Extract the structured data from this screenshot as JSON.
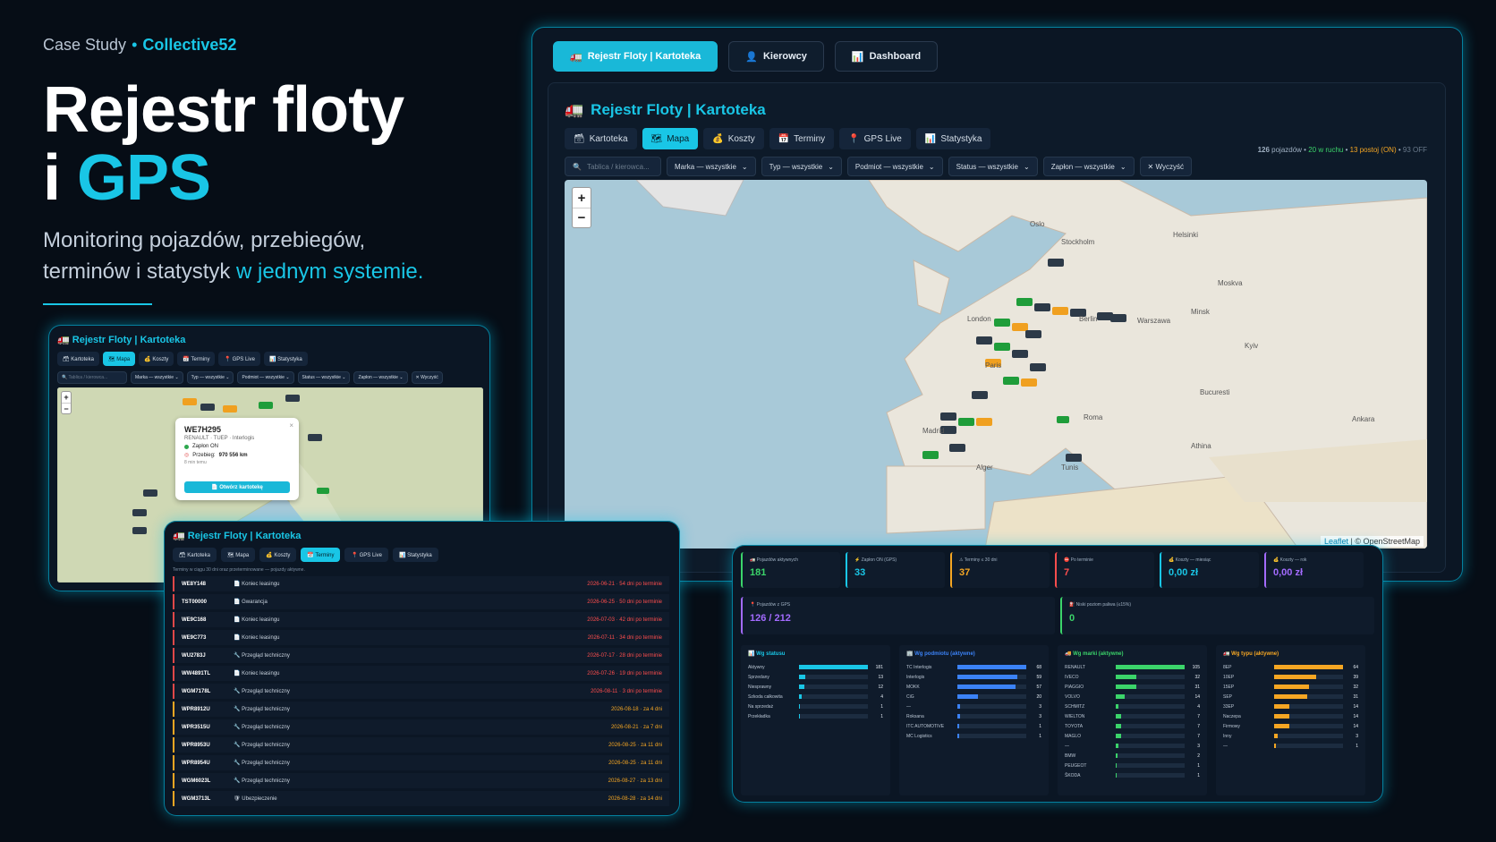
{
  "hero": {
    "kicker": "Case Study",
    "bullet": "•",
    "brand": "Collective52",
    "title_line1": "Rejestr floty",
    "title_line2_prefix": "i ",
    "title_line2_accent": "GPS",
    "subtitle_line1": "Monitoring pojazdów, przebiegów,",
    "subtitle_line2_prefix": "terminów i statystyk ",
    "subtitle_line2_accent": "w jednym systemie."
  },
  "main": {
    "top_tabs": [
      {
        "label": "Rejestr Floty | Kartoteka",
        "icon": "🚛"
      },
      {
        "label": "Kierowcy",
        "icon": "👤"
      },
      {
        "label": "Dashboard",
        "icon": "📊"
      }
    ],
    "title": "Rejestr Floty | Kartoteka",
    "title_icon": "🚛",
    "tabs": [
      {
        "label": "Kartoteka",
        "icon": "🗃"
      },
      {
        "label": "Mapa",
        "icon": "🗺"
      },
      {
        "label": "Koszty",
        "icon": "💰"
      },
      {
        "label": "Terminy",
        "icon": "📅"
      },
      {
        "label": "GPS Live",
        "icon": "📍"
      },
      {
        "label": "Statystyka",
        "icon": "📊"
      }
    ],
    "stats": {
      "count": "126",
      "count_label": " pojazdów •",
      "moving": " 20 w ruchu",
      "sep": " •",
      "idle": " 13 postoj (ON)",
      "sep2": " •",
      "off": " 93 OFF"
    },
    "search_placeholder": "Tablica / kierowca...",
    "search_icon": "🔍",
    "filters": [
      "Marka — wszystkie",
      "Typ — wszystkie",
      "Podmiot — wszystkie",
      "Status — wszystkie",
      "Zapłon — wszystkie"
    ],
    "clear_label": "✕ Wyczyść",
    "zoom_in": "+",
    "zoom_out": "−",
    "attribution_leaflet": "Leaflet",
    "attribution_sep": " | © OpenStreetMap",
    "cities": [
      "Oslo",
      "Stockholm",
      "Moskva",
      "London",
      "Roma",
      "Madrid",
      "Alger",
      "Tunis",
      "Helsinki",
      "Kyiv",
      "Ankara",
      "Minsk",
      "Warszawa",
      "Berlin",
      "Paris",
      "Bucuresti",
      "Athina"
    ]
  },
  "small_map": {
    "title": "🚛 Rejestr Floty | Kartoteka",
    "tabs": [
      "🗃 Kartoteka",
      "🗺 Mapa",
      "💰 Koszty",
      "📅 Terminy",
      "📍 GPS Live",
      "📊 Statystyka"
    ],
    "search_placeholder": "🔍 Tablica / kierowca...",
    "filters": [
      "Marka — wszystkie ⌄",
      "Typ — wszystkie ⌄",
      "Podmiot — wszystkie ⌄",
      "Status — wszystkie ⌄",
      "Zapłon — wszystkie ⌄",
      "✕ Wyczyść"
    ],
    "zoom_in": "+",
    "zoom_out": "−",
    "popup": {
      "plate": "WE7H295",
      "model": "RENAULT · TUEP · Interlogis",
      "ignition": "Zapłon ON",
      "mileage_label": "Przebieg: ",
      "mileage_value": "970 556 km",
      "time": "8 min temu",
      "button": "📄 Otwórz kartotekę",
      "close": "×"
    }
  },
  "terms": {
    "title": "🚛 Rejestr Floty | Kartoteka",
    "tabs": [
      "🗃 Kartoteka",
      "🗺 Mapa",
      "💰 Koszty",
      "📅 Terminy",
      "📍 GPS Live",
      "📊 Statystyka"
    ],
    "note": "Terminy w ciągu 30 dni oraz przeterminowane — pojazdy aktywne.",
    "rows": [
      {
        "plate": "WE8Y148",
        "name": "📄 Koniec leasingu",
        "date": "2026-06-21 · 54 dni po terminie",
        "kind": "red"
      },
      {
        "plate": "TST00000",
        "name": "📄 Gwarancja",
        "date": "2026-06-25 · 50 dni po terminie",
        "kind": "red"
      },
      {
        "plate": "WE9C168",
        "name": "📄 Koniec leasingu",
        "date": "2026-07-03 · 42 dni po terminie",
        "kind": "red"
      },
      {
        "plate": "WE9C773",
        "name": "📄 Koniec leasingu",
        "date": "2026-07-11 · 34 dni po terminie",
        "kind": "red"
      },
      {
        "plate": "WU2783J",
        "name": "🔧 Przegląd techniczny",
        "date": "2026-07-17 · 28 dni po terminie",
        "kind": "red"
      },
      {
        "plate": "WW4891TL",
        "name": "📄 Koniec leasingu",
        "date": "2026-07-26 · 19 dni po terminie",
        "kind": "red"
      },
      {
        "plate": "WGM7178L",
        "name": "🔧 Przegląd techniczny",
        "date": "2026-08-11 · 3 dni po terminie",
        "kind": "red"
      },
      {
        "plate": "WPR8912U",
        "name": "🔧 Przegląd techniczny",
        "date": "2026-08-18 · za 4 dni",
        "kind": "orange"
      },
      {
        "plate": "WPR3515U",
        "name": "🔧 Przegląd techniczny",
        "date": "2026-08-21 · za 7 dni",
        "kind": "orange"
      },
      {
        "plate": "WPR8953U",
        "name": "🔧 Przegląd techniczny",
        "date": "2026-08-25 · za 11 dni",
        "kind": "orange"
      },
      {
        "plate": "WPR8954U",
        "name": "🔧 Przegląd techniczny",
        "date": "2026-08-25 · za 11 dni",
        "kind": "orange"
      },
      {
        "plate": "WGM6023L",
        "name": "🔧 Przegląd techniczny",
        "date": "2026-08-27 · za 13 dni",
        "kind": "orange"
      },
      {
        "plate": "WGM3713L",
        "name": "🛡 Ubezpieczenie",
        "date": "2026-08-28 · za 14 dni",
        "kind": "orange"
      }
    ]
  },
  "statistics": {
    "kpis": [
      {
        "label": "🚛 Pojazdów aktywnych",
        "value": "181",
        "color": "#3bd46a"
      },
      {
        "label": "⚡ Zapłon ON (GPS)",
        "value": "33",
        "color": "#19c6e6"
      },
      {
        "label": "⚠ Terminy ≤ 30 dni",
        "value": "37",
        "color": "#f5a623"
      },
      {
        "label": "⛔ Po terminie",
        "value": "7",
        "color": "#ff4d4d"
      },
      {
        "label": "💰 Koszty — miesiąc",
        "value": "0,00 zł",
        "color": "#19c6e6"
      },
      {
        "label": "💰 Koszty — rok",
        "value": "0,00 zł",
        "color": "#a36bff"
      }
    ],
    "kpis2": [
      {
        "label": "📍 Pojazdów z GPS",
        "value": "126 / 212",
        "color": "#a36bff"
      },
      {
        "label": "⛽ Niski poziom paliwa (≤15%)",
        "value": "0",
        "color": "#3bd46a"
      }
    ],
    "panels": [
      {
        "title": "📊 Wg statusu",
        "color": "#19c6e6",
        "rows": [
          {
            "label": "Aktywny",
            "value": 181,
            "frac": 1.0
          },
          {
            "label": "Sprzedany",
            "value": 13,
            "frac": 0.09
          },
          {
            "label": "Niesprawny",
            "value": 12,
            "frac": 0.08
          },
          {
            "label": "Szkoda całkowita",
            "value": 4,
            "frac": 0.03
          },
          {
            "label": "Na sprzedaż",
            "value": 1,
            "frac": 0.01
          },
          {
            "label": "Przekładka",
            "value": 1,
            "frac": 0.01
          }
        ]
      },
      {
        "title": "🏢 Wg podmiotu (aktywne)",
        "color": "#3b82f6",
        "rows": [
          {
            "label": "TC Interlogis",
            "value": 68,
            "frac": 1.0
          },
          {
            "label": "Interlogis",
            "value": 59,
            "frac": 0.87
          },
          {
            "label": "MOKK",
            "value": 57,
            "frac": 0.84
          },
          {
            "label": "CiG",
            "value": 20,
            "frac": 0.3
          },
          {
            "label": "—",
            "value": 3,
            "frac": 0.04
          },
          {
            "label": "Roksana",
            "value": 3,
            "frac": 0.04
          },
          {
            "label": "ITC AUTOMOTIVE",
            "value": 1,
            "frac": 0.02
          },
          {
            "label": "MC Logistics",
            "value": 1,
            "frac": 0.02
          }
        ]
      },
      {
        "title": "🚚 Wg marki (aktywne)",
        "color": "#3bd46a",
        "rows": [
          {
            "label": "RENAULT",
            "value": 105,
            "frac": 1.0
          },
          {
            "label": "IVECO",
            "value": 32,
            "frac": 0.3
          },
          {
            "label": "PIAGGIO",
            "value": 31,
            "frac": 0.3
          },
          {
            "label": "VOLVO",
            "value": 14,
            "frac": 0.13
          },
          {
            "label": "SCHMITZ",
            "value": 4,
            "frac": 0.04
          },
          {
            "label": "WIELTON",
            "value": 7,
            "frac": 0.07
          },
          {
            "label": "TOYOTA",
            "value": 7,
            "frac": 0.07
          },
          {
            "label": "MAGLO",
            "value": 7,
            "frac": 0.07
          },
          {
            "label": "—",
            "value": 3,
            "frac": 0.03
          },
          {
            "label": "BMW",
            "value": 2,
            "frac": 0.02
          },
          {
            "label": "PEUGEOT",
            "value": 1,
            "frac": 0.01
          },
          {
            "label": "ŠKODA",
            "value": 1,
            "frac": 0.01
          }
        ]
      },
      {
        "title": "🚛 Wg typu (aktywne)",
        "color": "#f5a623",
        "rows": [
          {
            "label": "8EP",
            "value": 64,
            "frac": 1.0
          },
          {
            "label": "10EP",
            "value": 39,
            "frac": 0.61
          },
          {
            "label": "15EP",
            "value": 32,
            "frac": 0.5
          },
          {
            "label": "SEP",
            "value": 31,
            "frac": 0.48
          },
          {
            "label": "33EP",
            "value": 14,
            "frac": 0.22
          },
          {
            "label": "Naczepa",
            "value": 14,
            "frac": 0.22
          },
          {
            "label": "Firmowy",
            "value": 14,
            "frac": 0.22
          },
          {
            "label": "Inny",
            "value": 3,
            "frac": 0.05
          },
          {
            "label": "—",
            "value": 1,
            "frac": 0.02
          }
        ]
      }
    ]
  }
}
